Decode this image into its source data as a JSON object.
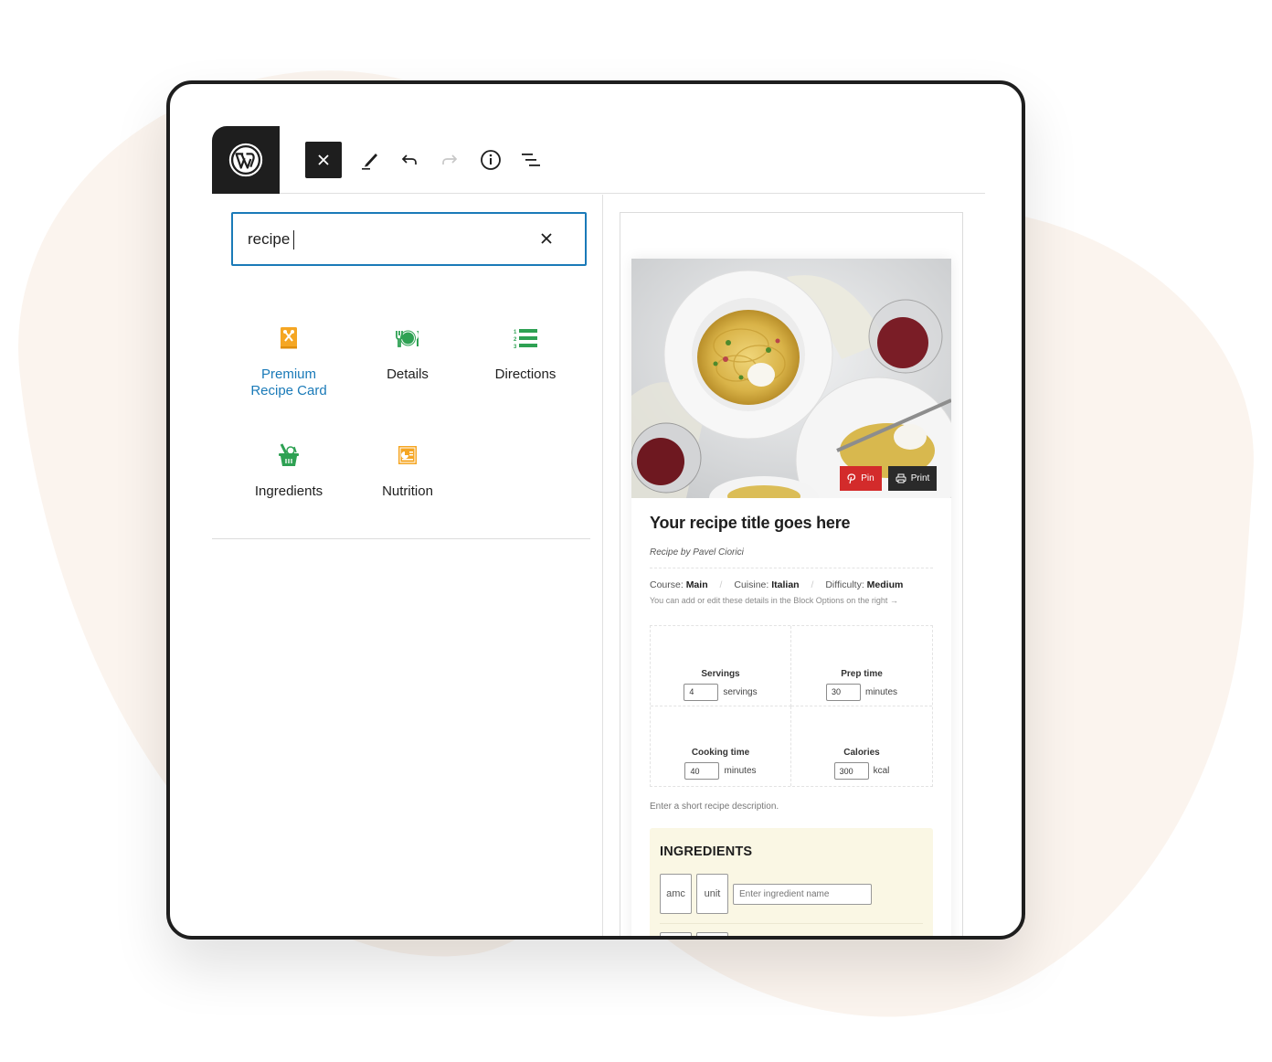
{
  "toolbar": {
    "logo": "wordpress-logo",
    "buttons": [
      {
        "name": "close",
        "icon": "close-icon"
      },
      {
        "name": "tools",
        "icon": "pencil-icon"
      },
      {
        "name": "undo",
        "icon": "undo-icon"
      },
      {
        "name": "redo",
        "icon": "redo-icon",
        "disabled": true
      },
      {
        "name": "details",
        "icon": "info-icon"
      },
      {
        "name": "list-view",
        "icon": "list-view-icon"
      }
    ]
  },
  "inserter": {
    "search_value": "recipe",
    "search_clear_icon": "close-icon",
    "blocks": [
      {
        "label_line1": "Premium",
        "label_line2": "Recipe Card",
        "icon": "recipe-card-icon",
        "color": "#f5a623",
        "active": true
      },
      {
        "label_line1": "Details",
        "label_line2": "",
        "icon": "dinner-plate-icon",
        "color": "#2ea153"
      },
      {
        "label_line1": "Directions",
        "label_line2": "",
        "icon": "numbered-list-icon",
        "color": "#2ea153"
      },
      {
        "label_line1": "Ingredients",
        "label_line2": "",
        "icon": "basket-icon",
        "color": "#2ea153"
      },
      {
        "label_line1": "Nutrition",
        "label_line2": "",
        "icon": "nutrition-chart-icon",
        "color": "#f5a623"
      }
    ]
  },
  "recipe": {
    "photo_alt": "Spaghetti dish with wine",
    "pin_label": "Pin",
    "print_label": "Print",
    "title": "Your recipe title goes here",
    "author": "Recipe by Pavel Ciorici",
    "meta": {
      "course_label": "Course:",
      "course_value": "Main",
      "cuisine_label": "Cuisine:",
      "cuisine_value": "Italian",
      "difficulty_label": "Difficulty:",
      "difficulty_value": "Medium",
      "separator": "/"
    },
    "hint": "You can add or edit these details in the Block Options on the right →",
    "details": [
      {
        "label": "Servings",
        "value": "4",
        "unit": "servings"
      },
      {
        "label": "Prep time",
        "value": "30",
        "unit": "minutes"
      },
      {
        "label": "Cooking time",
        "value": "40",
        "unit": "minutes"
      },
      {
        "label": "Calories",
        "value": "300",
        "unit": "kcal"
      }
    ],
    "description_placeholder": "Enter a short recipe description.",
    "ingredients": {
      "title": "INGREDIENTS",
      "amount_placeholder": "amc",
      "unit_placeholder": "unit",
      "name_placeholder": "Enter ingredient name"
    }
  },
  "colors": {
    "accent": "#1a7ab8",
    "dark": "#1e1e1e",
    "pin_red": "#d32b2b",
    "ingredients_bg": "#faf7e4",
    "background_blob": "#fbf4ee"
  }
}
